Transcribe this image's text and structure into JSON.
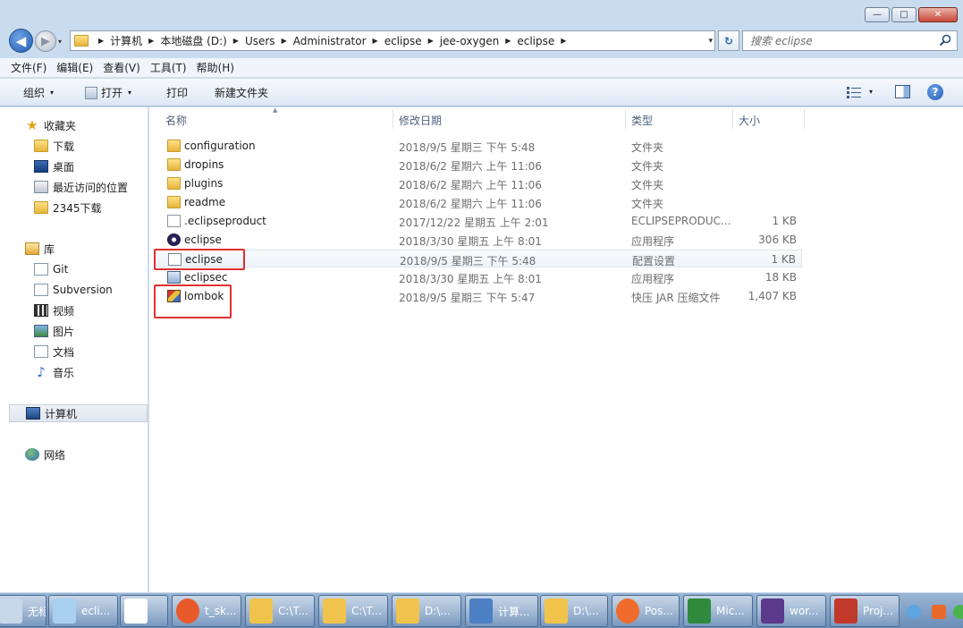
{
  "window": {
    "caption": {
      "minimize": "—",
      "maximize": "□",
      "close": "✕"
    },
    "nav": {
      "back": "◀",
      "forward": "▶",
      "history": "▾"
    },
    "address": {
      "crumbs": [
        "计算机",
        "本地磁盘 (D:)",
        "Users",
        "Administrator",
        "eclipse",
        "jee-oxygen",
        "eclipse"
      ],
      "separator": "▶",
      "dropdown": "▾",
      "refresh": "↻"
    },
    "search": {
      "placeholder": "搜索 eclipse"
    }
  },
  "menu": [
    "文件(F)",
    "编辑(E)",
    "查看(V)",
    "工具(T)",
    "帮助(H)"
  ],
  "toolbar": {
    "organize": "组织",
    "open": "打开",
    "print": "打印",
    "new_folder": "新建文件夹",
    "arrow": "▾",
    "help": "?"
  },
  "navpane": {
    "favorites": {
      "label": "收藏夹",
      "items": [
        "下载",
        "桌面",
        "最近访问的位置",
        "2345下载"
      ]
    },
    "libraries": {
      "label": "库",
      "items": [
        "Git",
        "Subversion",
        "视频",
        "图片",
        "文档",
        "音乐"
      ]
    },
    "computer": "计算机",
    "network": "网络"
  },
  "columns": {
    "name": "名称",
    "date": "修改日期",
    "type": "类型",
    "size": "大小",
    "sort_indicator": "▲"
  },
  "files": [
    {
      "name": "configuration",
      "date": "2018/9/5 星期三 下午 5:48",
      "type": "文件夹",
      "size": "",
      "icon": "folder-icon"
    },
    {
      "name": "dropins",
      "date": "2018/6/2 星期六 上午 11:06",
      "type": "文件夹",
      "size": "",
      "icon": "folder-icon"
    },
    {
      "name": "plugins",
      "date": "2018/6/2 星期六 上午 11:06",
      "type": "文件夹",
      "size": "",
      "icon": "folder-icon"
    },
    {
      "name": "readme",
      "date": "2018/6/2 星期六 上午 11:06",
      "type": "文件夹",
      "size": "",
      "icon": "folder-icon"
    },
    {
      "name": ".eclipseproduct",
      "date": "2017/12/22 星期五 上午 2:01",
      "type": "ECLIPSEPRODUC...",
      "size": "1 KB",
      "icon": "blank-file-icon"
    },
    {
      "name": "eclipse",
      "date": "2018/3/30 星期五 上午 8:01",
      "type": "应用程序",
      "size": "306 KB",
      "icon": "eclipse-app-icon"
    },
    {
      "name": "eclipse",
      "date": "2018/9/5 星期三 下午 5:48",
      "type": "配置设置",
      "size": "1 KB",
      "icon": "config-file-icon"
    },
    {
      "name": "eclipsec",
      "date": "2018/3/30 星期五 上午 8:01",
      "type": "应用程序",
      "size": "18 KB",
      "icon": "console-app-icon"
    },
    {
      "name": "lombok",
      "date": "2018/9/5 星期三 下午 5:47",
      "type": "快压 JAR 压缩文件",
      "size": "1,407 KB",
      "icon": "jar-archive-icon"
    }
  ],
  "taskbar": [
    {
      "label": "无标...",
      "icon": "paint-icon",
      "color": "#c7d7ea"
    },
    {
      "label": "ecli...",
      "icon": "notepad-icon",
      "color": "#a9d0f0"
    },
    {
      "label": "",
      "icon": "document-icon",
      "color": "#ffffff"
    },
    {
      "label": "t_sk...",
      "icon": "browser-icon",
      "color": "#e85a2a"
    },
    {
      "label": "C:\\T...",
      "icon": "folder-icon",
      "color": "#f0c44c"
    },
    {
      "label": "C:\\T...",
      "icon": "folder-icon",
      "color": "#f0c44c"
    },
    {
      "label": "D:\\...",
      "icon": "folder-icon",
      "color": "#f0c44c"
    },
    {
      "label": "计算...",
      "icon": "computer-icon",
      "color": "#4d7fc4"
    },
    {
      "label": "D:\\...",
      "icon": "folder-icon",
      "color": "#f0c44c"
    },
    {
      "label": "Pos...",
      "icon": "postman-icon",
      "color": "#ef6c2c"
    },
    {
      "label": "Mic...",
      "icon": "excel-icon",
      "color": "#2f8a3e"
    },
    {
      "label": "wor...",
      "icon": "eclipse-ee-icon",
      "color": "#5b3a8c"
    },
    {
      "label": "Proj...",
      "icon": "project-icon",
      "color": "#c0392b"
    }
  ],
  "colors": {
    "highlight_box": "#e03030",
    "window_frame": "#c9dcef",
    "taskbar": "#6a8db7"
  }
}
